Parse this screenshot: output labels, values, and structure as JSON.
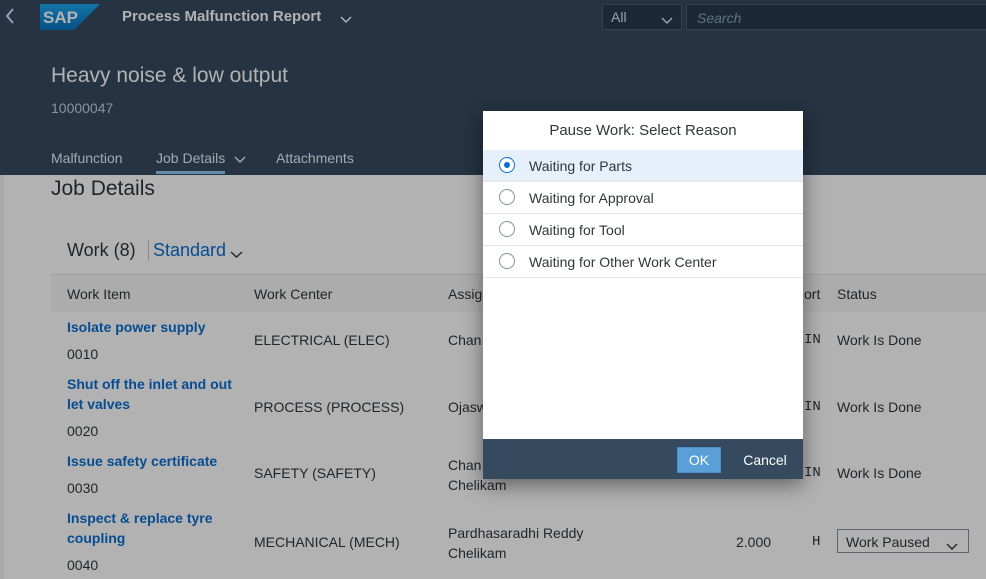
{
  "shell": {
    "app_title": "Process Malfunction Report",
    "scope_value": "All",
    "search_placeholder": "Search"
  },
  "header": {
    "title": "Heavy noise & low output",
    "id": "10000047",
    "tabs": [
      {
        "label": "Malfunction",
        "selected": false
      },
      {
        "label": "Job Details",
        "selected": true
      },
      {
        "label": "Attachments",
        "selected": false
      }
    ]
  },
  "content": {
    "section_title": "Job Details",
    "table_title": "Work (8)",
    "variant": "Standard",
    "columns": [
      "Work Item",
      "Work Center",
      "Assig",
      "ort",
      "Status"
    ],
    "rows": [
      {
        "item": "Isolate power supply",
        "number": "0010",
        "center": "ELECTRICAL (ELEC)",
        "assignee": "Chan",
        "effort": "",
        "unit": "IN",
        "status": "Work Is Done"
      },
      {
        "item_line1": "Shut off the inlet and out",
        "item_line2": "let valves",
        "number": "0020",
        "center": "PROCESS (PROCESS)",
        "assignee": "Ojasw",
        "effort": "",
        "unit": "IN",
        "status": "Work Is Done"
      },
      {
        "item": "Issue safety certificate",
        "number": "0030",
        "center": "SAFETY (SAFETY)",
        "assignee_line1": "Chan",
        "assignee_line2": "Chelikam",
        "effort": "",
        "unit": "IN",
        "status": "Work Is Done"
      },
      {
        "item_line1": "Inspect & replace tyre",
        "item_line2": "coupling",
        "number": "0040",
        "center": "MECHANICAL (MECH)",
        "assignee_line1": "Pardhasaradhi Reddy",
        "assignee_line2": "Chelikam",
        "effort": "2.000",
        "unit": "H",
        "status": "Work Paused"
      }
    ]
  },
  "dialog": {
    "title": "Pause Work: Select Reason",
    "options": [
      {
        "label": "Waiting for Parts",
        "selected": true
      },
      {
        "label": "Waiting for Approval",
        "selected": false
      },
      {
        "label": "Waiting for Tool",
        "selected": false
      },
      {
        "label": "Waiting for Other Work Center",
        "selected": false
      }
    ],
    "ok_label": "OK",
    "cancel_label": "Cancel"
  },
  "colors": {
    "shell": "#354a5f",
    "accent": "#0a6ed1",
    "ok_button": "#5b9fd7"
  }
}
